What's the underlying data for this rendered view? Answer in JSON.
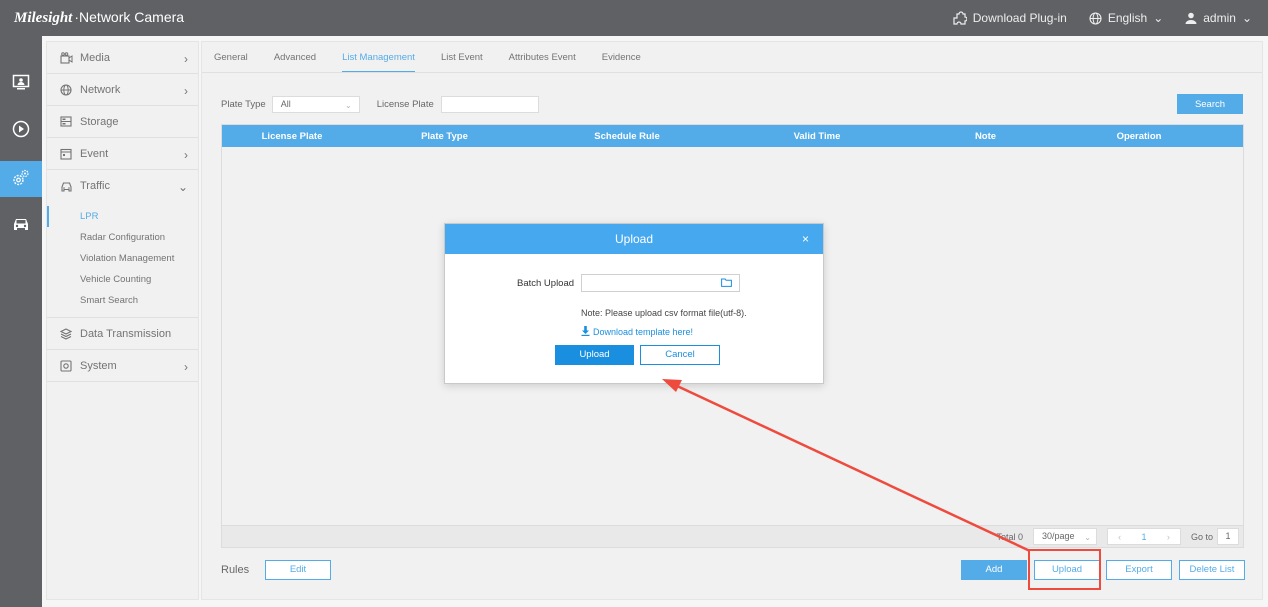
{
  "header": {
    "brand_logo": "Milesight",
    "brand_name": "Network Camera",
    "download_plugin": "Download Plug-in",
    "language": "English",
    "user": "admin"
  },
  "rail": {
    "icons": [
      "monitor-icon",
      "playback-icon",
      "settings-icon",
      "vehicle-icon"
    ],
    "active_index": 2
  },
  "menu": {
    "items": [
      {
        "label": "Media",
        "icon": "media-icon",
        "chevron": "›"
      },
      {
        "label": "Network",
        "icon": "globe-icon",
        "chevron": "›"
      },
      {
        "label": "Storage",
        "icon": "storage-icon",
        "chevron": ""
      },
      {
        "label": "Event",
        "icon": "event-icon",
        "chevron": "›"
      },
      {
        "label": "Traffic",
        "icon": "car-icon",
        "chevron": "⌄"
      }
    ],
    "submenu": [
      "LPR",
      "Radar Configuration",
      "Violation Management",
      "Vehicle Counting",
      "Smart Search"
    ],
    "active_sub": 0,
    "items_after": [
      {
        "label": "Data Transmission",
        "icon": "layers-icon",
        "chevron": ""
      },
      {
        "label": "System",
        "icon": "system-icon",
        "chevron": "›"
      }
    ]
  },
  "tabs": [
    "General",
    "Advanced",
    "List Management",
    "List Event",
    "Attributes Event",
    "Evidence"
  ],
  "active_tab": 2,
  "filter": {
    "plate_type_label": "Plate Type",
    "plate_type_value": "All",
    "license_plate_label": "License Plate",
    "search_label": "Search"
  },
  "table": {
    "columns": [
      "License Plate",
      "Plate Type",
      "Schedule Rule",
      "Valid Time",
      "Note",
      "Operation"
    ]
  },
  "pager": {
    "total": "Total 0",
    "per_page": "30/page",
    "page": "1",
    "goto_label": "Go to",
    "goto_value": "1",
    "prev": "‹",
    "next": "›"
  },
  "footer": {
    "rules_label": "Rules",
    "edit_label": "Edit",
    "add_label": "Add",
    "upload_label": "Upload",
    "export_label": "Export",
    "delete_list_label": "Delete List"
  },
  "dialog": {
    "title": "Upload",
    "close": "×",
    "batch_upload_label": "Batch Upload",
    "note": "Note: Please upload csv format file(utf-8).",
    "download_template": "Download template here!",
    "upload_btn": "Upload",
    "cancel_btn": "Cancel"
  },
  "colors": {
    "accent": "#1a8fe0",
    "dialog_header": "#46a9f0",
    "annotation": "#ef4a3e",
    "topbar": "#2a2d31"
  }
}
